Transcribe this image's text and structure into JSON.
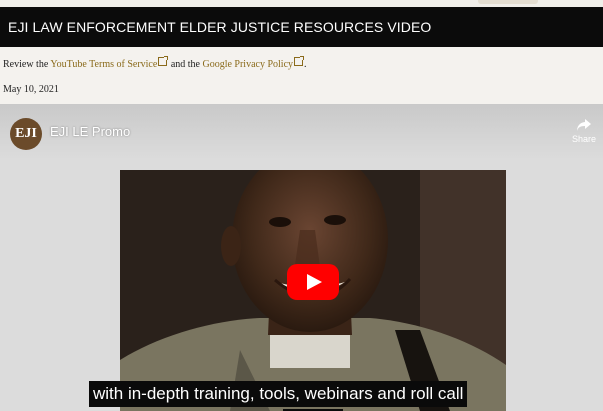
{
  "page": {
    "header_title": "EJI LAW ENFORCEMENT ELDER JUSTICE RESOURCES VIDEO",
    "terms": {
      "prefix": "Review the ",
      "youtube_link": "YouTube Terms of Service",
      "middle": " and the ",
      "google_link": "Google Privacy Policy",
      "suffix": "."
    },
    "date": "May 10, 2021"
  },
  "player": {
    "channel_logo_text": "EJI",
    "video_title": "EJI LE Promo",
    "share_label": "Share",
    "caption": "with in-depth training, tools, webinars and roll call",
    "play_icon": "youtube-play-icon"
  },
  "colors": {
    "header_bg": "#0b0b0b",
    "link": "#8a6a1a",
    "play_red": "#ff0000"
  }
}
